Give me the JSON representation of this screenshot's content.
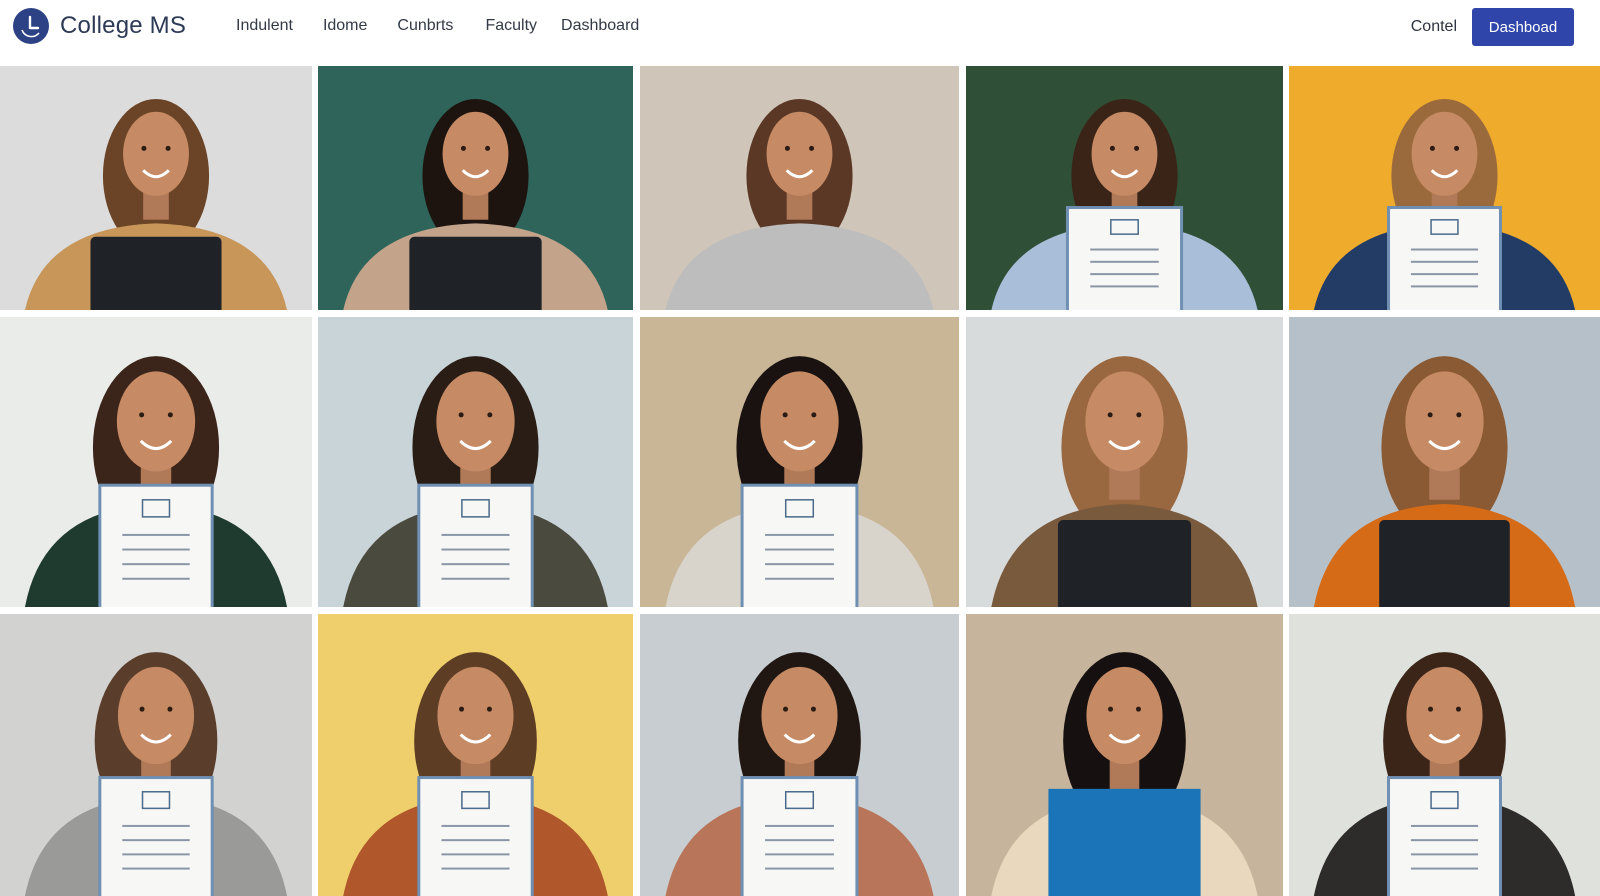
{
  "header": {
    "brand": "College MS",
    "nav": [
      "Indulent",
      "Idome",
      "Cunbrts",
      "Faculty",
      "Dashboard"
    ],
    "contact_label": "Contel",
    "cta_label": "Dashboad"
  },
  "icons": {
    "logo": "clock-logo-icon"
  },
  "colors": {
    "brand": "#2c4285",
    "button": "#2f45aa"
  },
  "gallery": {
    "tiles": [
      {
        "subject": "student-waving",
        "bg": "#dcdcdc",
        "hair": "#6b4428",
        "top": "#c89658",
        "prop": "tablet"
      },
      {
        "subject": "student-with-laptop",
        "bg": "#2e6459",
        "hair": "#1d1410",
        "top": "#c3a38a",
        "prop": "laptop"
      },
      {
        "subject": "student-waving-glasses",
        "bg": "#cfc5b8",
        "hair": "#5b3826",
        "top": "#bdbdbd",
        "prop": "none"
      },
      {
        "subject": "student-with-certificate",
        "bg": "#2f4f36",
        "hair": "#3a2418",
        "top": "#a9bfd9",
        "prop": "certificate"
      },
      {
        "subject": "student-with-certificate-glasses",
        "bg": "#eeab2c",
        "hair": "#9a6a3c",
        "top": "#233c66",
        "prop": "certificate"
      },
      {
        "subject": "student-certificate-office",
        "bg": "#e9ece9",
        "hair": "#3b2419",
        "top": "#1f3a2e",
        "prop": "certificate"
      },
      {
        "subject": "student-certificate-window",
        "bg": "#c9d4d9",
        "hair": "#2a1d15",
        "top": "#4b4a3f",
        "prop": "certificate"
      },
      {
        "subject": "student-blue-certificate",
        "bg": "#c8b697",
        "hair": "#191210",
        "top": "#d8d4cc",
        "prop": "certificate"
      },
      {
        "subject": "student-with-laptop-vest",
        "bg": "#d7dbdb",
        "hair": "#9a6840",
        "top": "#7a5a3d",
        "prop": "laptop"
      },
      {
        "subject": "student-scarf-laptop",
        "bg": "#b6c0c9",
        "hair": "#8a5a34",
        "top": "#d56b17",
        "prop": "laptop"
      },
      {
        "subject": "student-hat-certificate",
        "bg": "#d2d2d0",
        "hair": "#5a3d2a",
        "top": "#9a9a98",
        "prop": "certificate"
      },
      {
        "subject": "student-glasses-certificate",
        "bg": "#efcf6c",
        "hair": "#5d3d24",
        "top": "#b0572b",
        "prop": "certificate"
      },
      {
        "subject": "student-curly-certificate",
        "bg": "#c7cdd0",
        "hair": "#201712",
        "top": "#b8755a",
        "prop": "certificate"
      },
      {
        "subject": "student-blue-folder",
        "bg": "#c7b49c",
        "hair": "#161110",
        "top": "#e9d8bd",
        "prop": "folder"
      },
      {
        "subject": "student-glasses-certificate-plants",
        "bg": "#dfe1dd",
        "hair": "#3b2519",
        "top": "#2d2c2b",
        "prop": "certificate"
      }
    ]
  }
}
